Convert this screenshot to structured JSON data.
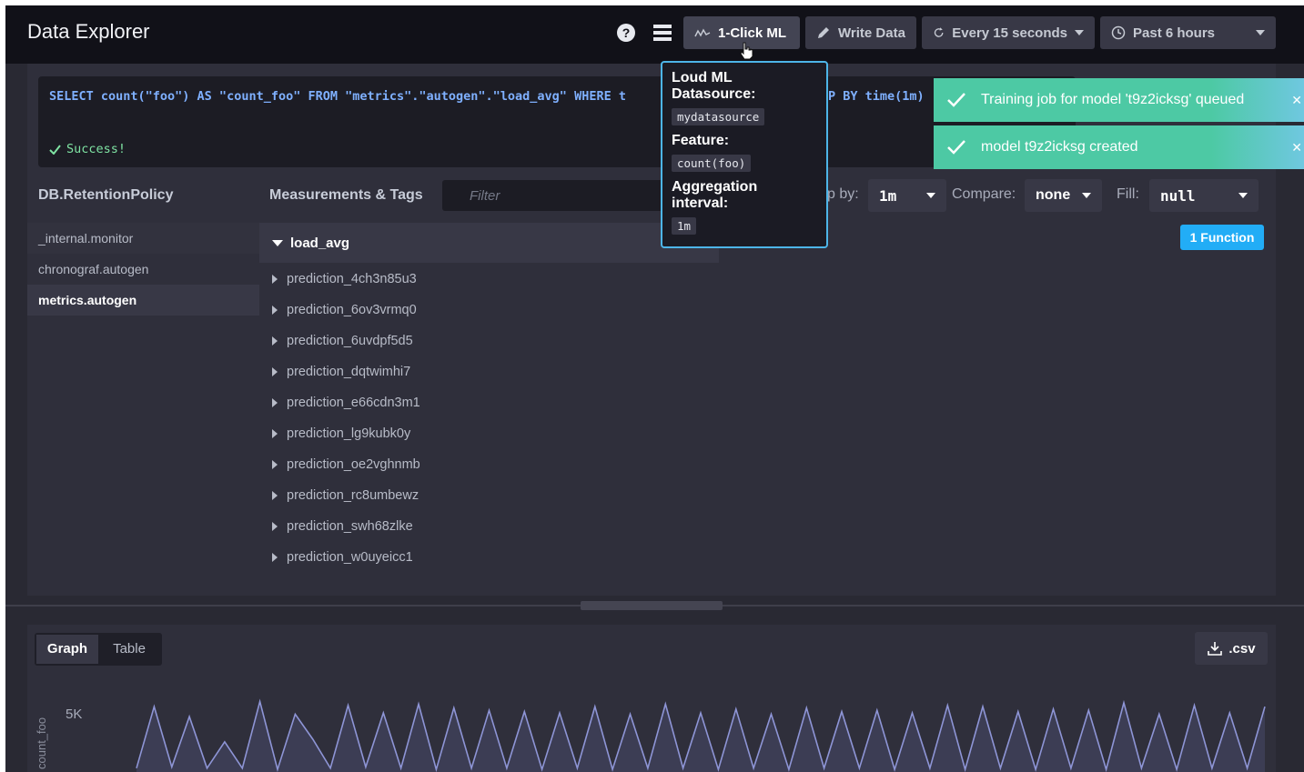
{
  "header": {
    "title": "Data Explorer",
    "buttons": {
      "ml": "1-Click ML",
      "write": "Write Data",
      "refresh": "Every 15 seconds",
      "range": "Past 6 hours"
    }
  },
  "query": {
    "text": "SELECT count(\"foo\") AS \"count_foo\" FROM \"metrics\".\"autogen\".\"load_avg\" WHERE t",
    "text_tail": "P BY time(1m)",
    "status": "Success!"
  },
  "tooltip": {
    "datasource_label": "Loud ML Datasource:",
    "datasource_value": "mydatasource",
    "feature_label": "Feature:",
    "feature_value": "count(foo)",
    "interval_label": "Aggregation interval:",
    "interval_value": "1m"
  },
  "notifications": [
    {
      "text": "Training job for model 't9z2icksg' queued"
    },
    {
      "text": "model t9z2icksg created"
    }
  ],
  "schema": {
    "db_header": "DB.RetentionPolicy",
    "meas_header": "Measurements & Tags",
    "filter_placeholder": "Filter",
    "databases": [
      "_internal.monitor",
      "chronograf.autogen",
      "metrics.autogen"
    ],
    "selected_measurement": "load_avg",
    "measurements": [
      "prediction_4ch3n85u3",
      "prediction_6ov3vrmq0",
      "prediction_6uvdpf5d5",
      "prediction_dqtwimhi7",
      "prediction_e66cdn3m1",
      "prediction_lg9kubk0y",
      "prediction_oe2vghnmb",
      "prediction_rc8umbewz",
      "prediction_swh68zlke",
      "prediction_w0uyeicc1"
    ]
  },
  "controls": {
    "group_label": "p by:",
    "group_value": "1m",
    "compare_label": "Compare:",
    "compare_value": "none",
    "fill_label": "Fill:",
    "fill_value": "null",
    "function_badge": "1 Function"
  },
  "graph": {
    "tabs": [
      "Graph",
      "Table"
    ],
    "active_tab": "Graph",
    "csv_label": ".csv",
    "y_label": "count_foo",
    "y_tick": "5K",
    "line_color": "#8e95d6"
  },
  "chart_data": {
    "type": "area",
    "ylabel": "count_foo",
    "y_ticks": [
      "5K"
    ],
    "values": [
      300,
      5200,
      400,
      4400,
      300,
      2400,
      300,
      5600,
      200,
      4600,
      2600,
      300,
      5300,
      400,
      4700,
      300,
      5400,
      200,
      5100,
      300,
      4900,
      300,
      4800,
      200,
      4700,
      300,
      5200,
      200,
      4600,
      300,
      5400,
      300,
      4700,
      200,
      5000,
      300,
      4600,
      200,
      5100,
      300,
      4800,
      300,
      4900,
      200,
      4700,
      300,
      5300,
      200,
      5200,
      300,
      4800,
      200,
      5000,
      300,
      4900,
      200,
      5500,
      300,
      4600,
      200,
      5300,
      300,
      4700,
      300,
      5200
    ]
  }
}
